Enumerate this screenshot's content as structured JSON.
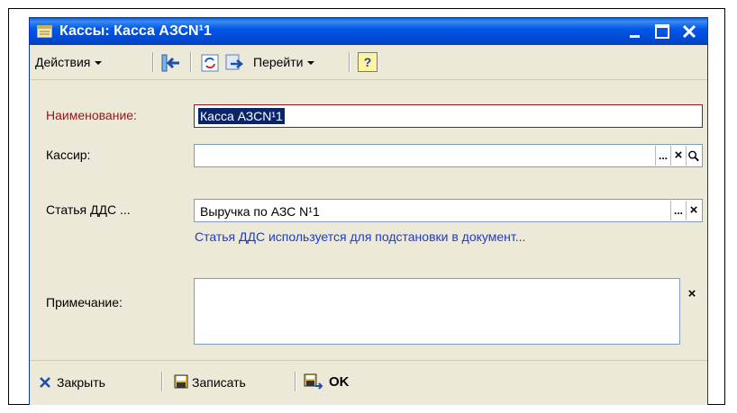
{
  "window": {
    "title": "Кассы: Касса АЗСN¹1"
  },
  "toolbar": {
    "actions_label": "Действия",
    "goto_label": "Перейти",
    "help_label": "?"
  },
  "form": {
    "name_label": "Наименование:",
    "name_value": "Касса АЗСN¹1",
    "cashier_label": "Кассир:",
    "cashier_value": "",
    "dds_label": "Статья ДДС ...",
    "dds_value": "Выручка по АЗС N¹1",
    "dds_hint": "Статья ДДС используется для подстановки в документ...",
    "note_label": "Примечание:",
    "note_value": "",
    "ellipsis": "...",
    "clear": "×"
  },
  "footer": {
    "close_label": "Закрыть",
    "save_label": "Записать",
    "ok_label": "OK"
  },
  "colors": {
    "title_bar": "#0058e6",
    "name_label": "#8b1a1a",
    "hint_link": "#1f3bc9",
    "window_bg": "#ece9d8"
  }
}
